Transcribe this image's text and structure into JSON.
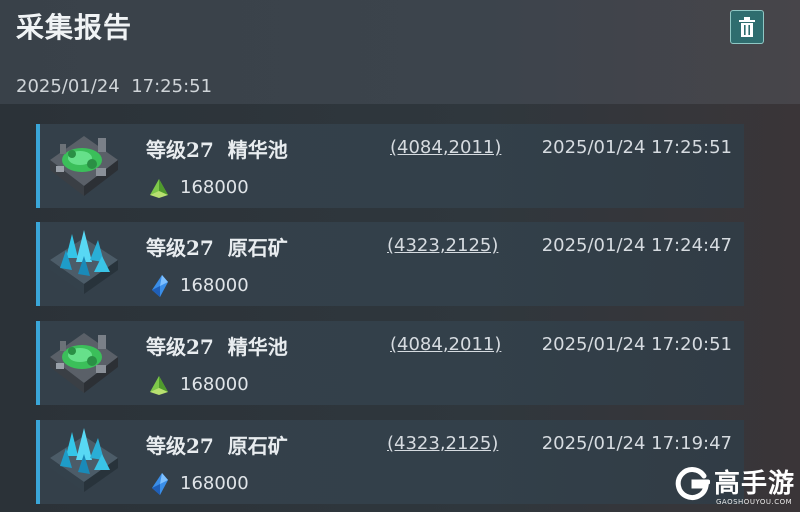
{
  "header": {
    "title": "采集报告",
    "time": "2025/01/24  17:25:51",
    "delete_icon": "trash-icon"
  },
  "reports": [
    {
      "title": "等级27  精华池",
      "coords": "(4084,2011)",
      "time": "2025/01/24 17:25:51",
      "amount": "168000",
      "building_icon": "essence-pool-icon",
      "resource_icon": "essence-icon"
    },
    {
      "title": "等级27  原石矿",
      "coords": "(4323,2125)",
      "time": "2025/01/24 17:24:47",
      "amount": "168000",
      "building_icon": "ore-mine-icon",
      "resource_icon": "crystal-icon"
    },
    {
      "title": "等级27  精华池",
      "coords": "(4084,2011)",
      "time": "2025/01/24 17:20:51",
      "amount": "168000",
      "building_icon": "essence-pool-icon",
      "resource_icon": "essence-icon"
    },
    {
      "title": "等级27  原石矿",
      "coords": "(4323,2125)",
      "time": "2025/01/24 17:19:47",
      "amount": "168000",
      "building_icon": "ore-mine-icon",
      "resource_icon": "crystal-icon"
    }
  ],
  "watermark": {
    "text": "高手游",
    "sub": "GAOSHOUYOU.COM"
  },
  "colors": {
    "accent_bar": "#3aa6d8",
    "trash_button": "#2f6d6f"
  }
}
